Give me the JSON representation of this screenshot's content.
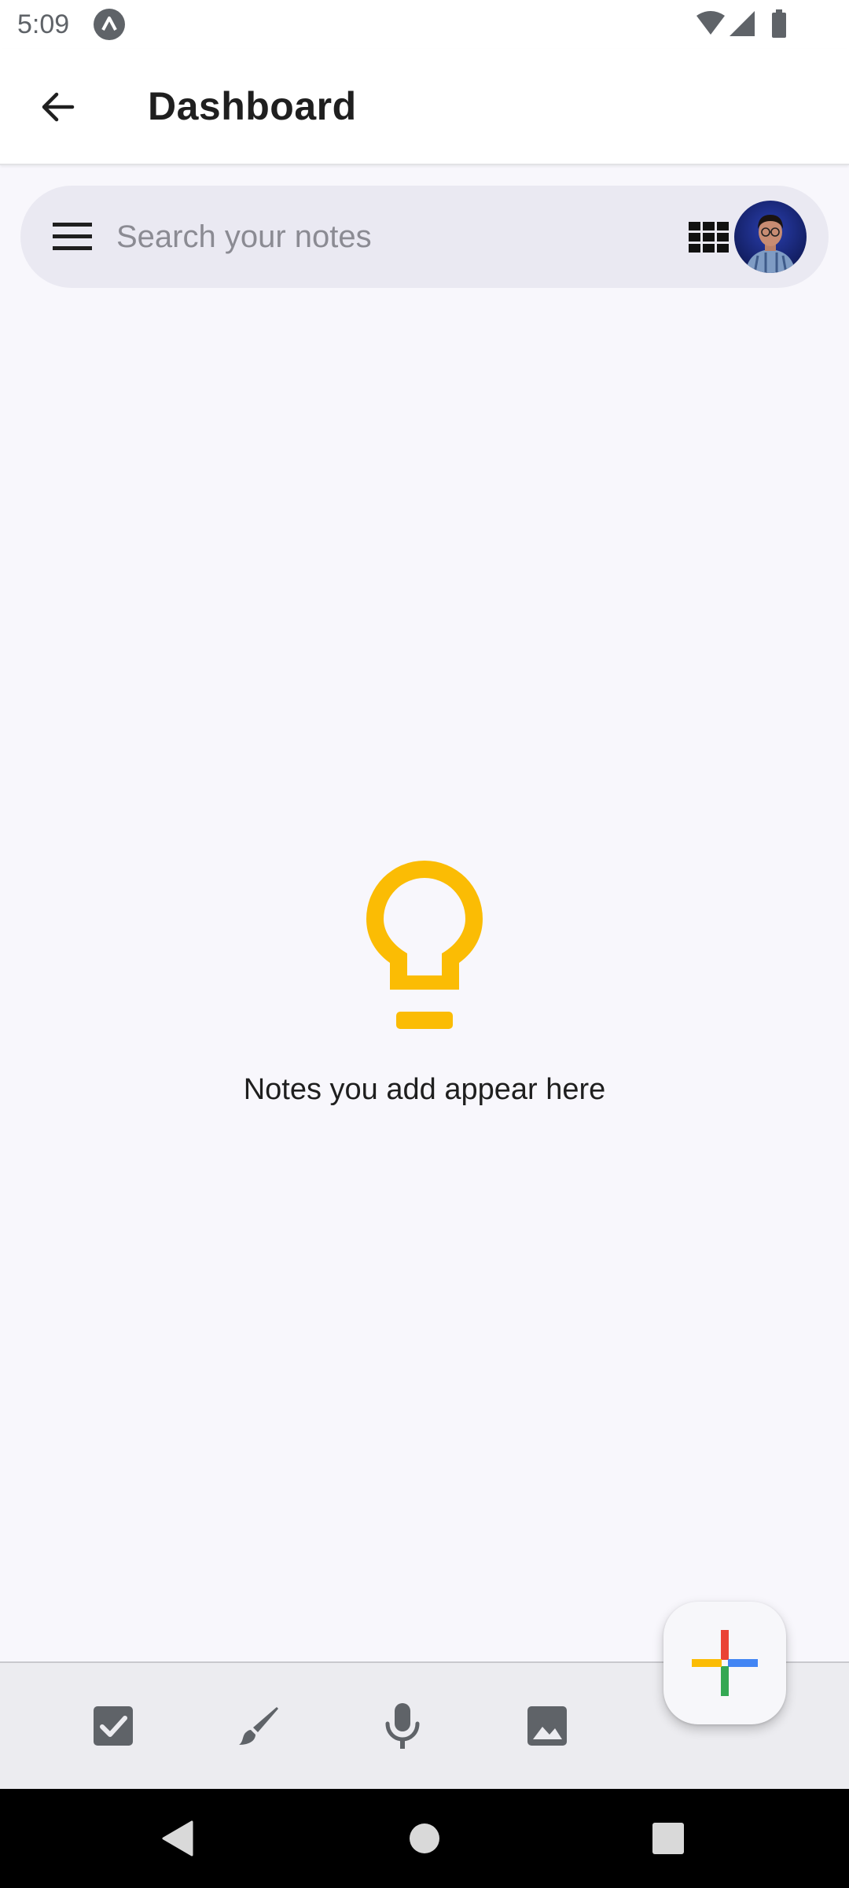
{
  "status_bar": {
    "time": "5:09",
    "icons": [
      "app-notification-icon",
      "wifi-icon",
      "cellular-signal-icon",
      "battery-icon"
    ]
  },
  "app_bar": {
    "title": "Dashboard",
    "back_icon": "arrow-back-icon"
  },
  "search": {
    "placeholder": "Search your notes",
    "value": "",
    "menu_icon": "hamburger-menu-icon",
    "view_icon": "grid-view-icon",
    "avatar": "profile-avatar"
  },
  "empty_state": {
    "icon": "lightbulb-icon",
    "icon_color": "#fbbc04",
    "message": "Notes you add appear here"
  },
  "bottom_bar": {
    "actions": [
      "checkbox-list-icon",
      "brush-icon",
      "microphone-icon",
      "image-icon"
    ]
  },
  "fab": {
    "icon": "colorful-plus-icon",
    "colors": [
      "#ea4335",
      "#4285f4",
      "#34a853",
      "#fbbc04"
    ]
  },
  "nav_bar": {
    "buttons": [
      "back-triangle-icon",
      "home-circle-icon",
      "recents-square-icon"
    ]
  }
}
